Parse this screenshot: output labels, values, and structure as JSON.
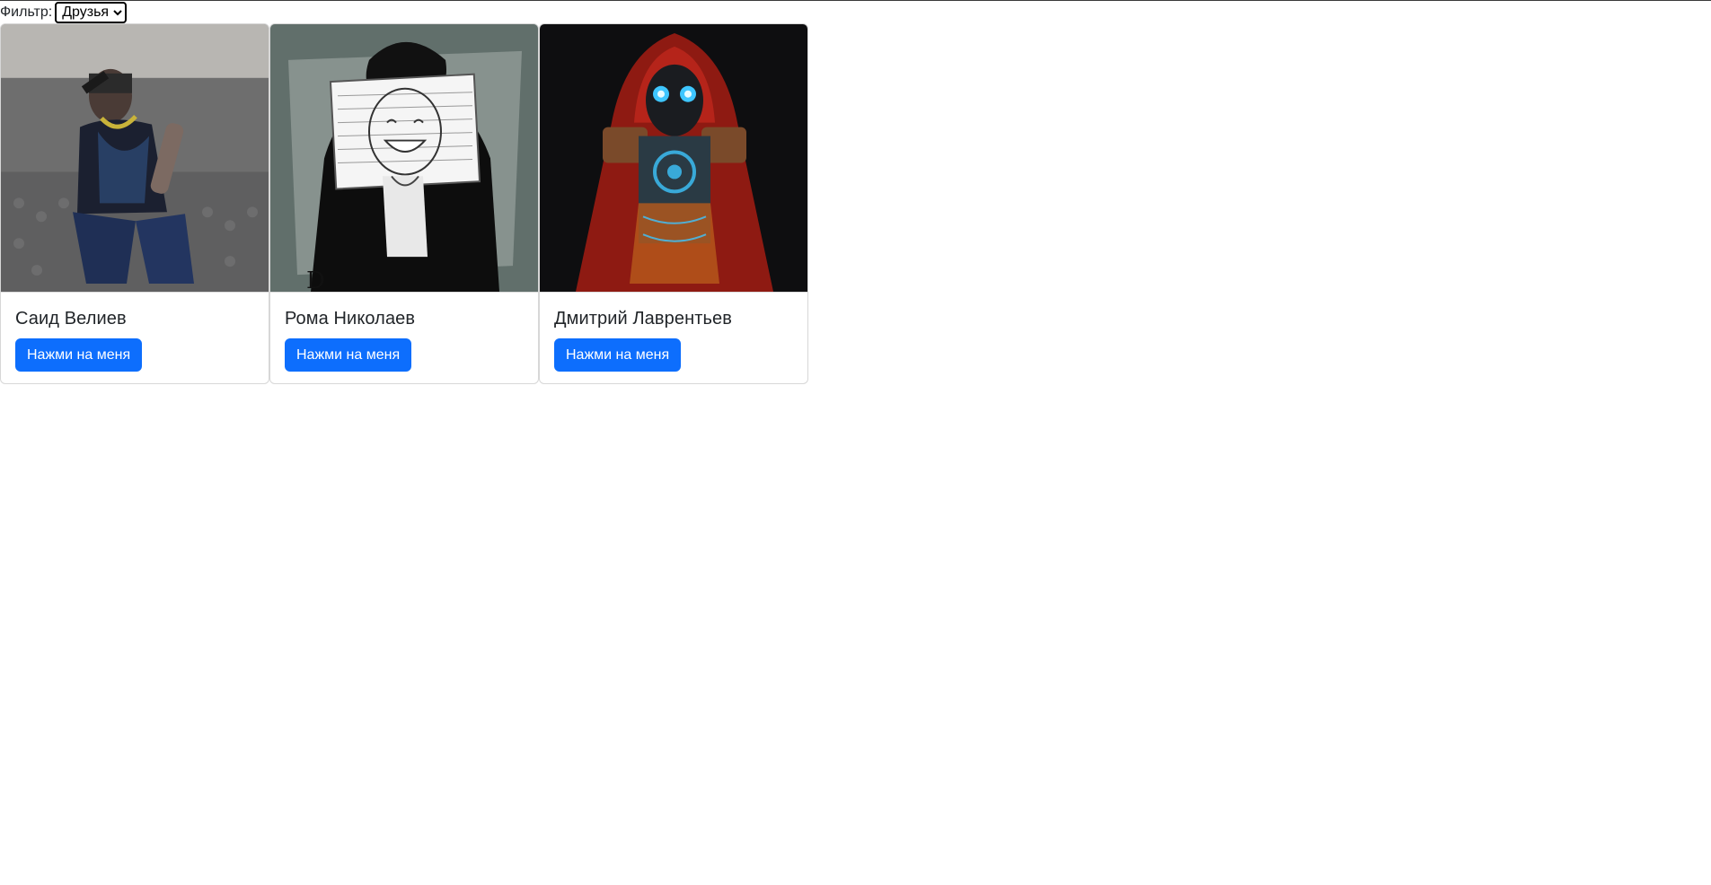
{
  "filter": {
    "label": "Фильтр:",
    "selected": "Друзья"
  },
  "cards": [
    {
      "name": "Саид Велиев",
      "button_label": "Нажми на меня",
      "image_icon": "photo-person-sofa"
    },
    {
      "name": "Рома Николаев",
      "button_label": "Нажми на меня",
      "image_icon": "drawing-mask-face"
    },
    {
      "name": "Дмитрий Лаврентьев",
      "button_label": "Нажми на меня",
      "image_icon": "red-hooded-robot-art"
    }
  ],
  "colors": {
    "button": "#0d6efd",
    "card_border": "#d7d7d7"
  }
}
